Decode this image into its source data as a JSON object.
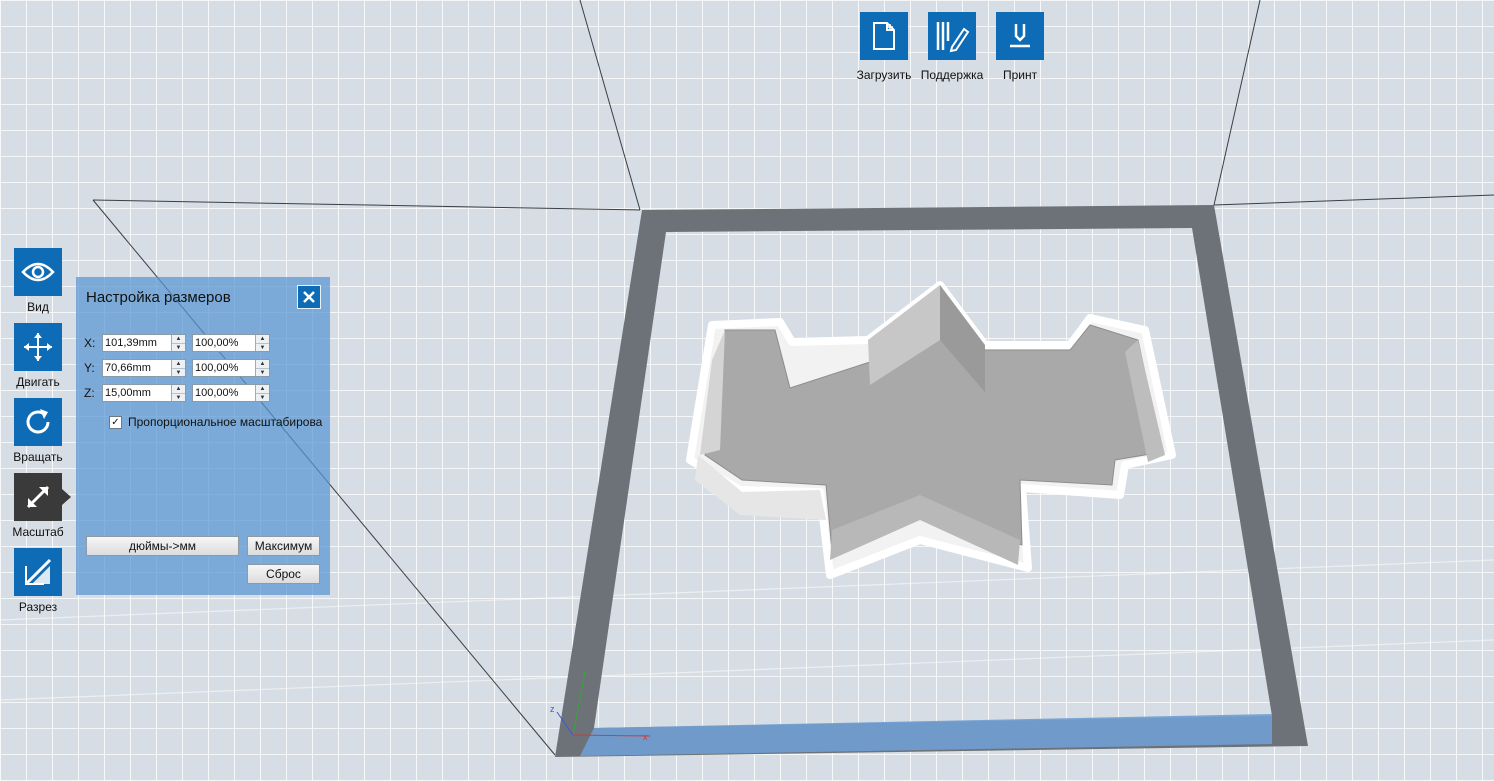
{
  "toolbar_top": [
    {
      "id": "load",
      "label": "Загрузить",
      "icon": "file-add-icon"
    },
    {
      "id": "support",
      "label": "Поддержка",
      "icon": "support-edit-icon"
    },
    {
      "id": "print",
      "label": "Принт",
      "icon": "print-nozzle-icon"
    }
  ],
  "toolbar_left": [
    {
      "id": "view",
      "label": "Вид",
      "icon": "eye-icon"
    },
    {
      "id": "move",
      "label": "Двигать",
      "icon": "move-arrows-icon"
    },
    {
      "id": "rotate",
      "label": "Вращать",
      "icon": "rotate-icon"
    },
    {
      "id": "scale",
      "label": "Масштаб",
      "icon": "scale-arrow-icon",
      "active": true
    },
    {
      "id": "cut",
      "label": "Разрез",
      "icon": "cut-icon"
    }
  ],
  "scale_panel": {
    "title": "Настройка размеров",
    "rows": [
      {
        "axis": "X:",
        "size": "101,39mm",
        "percent": "100,00%"
      },
      {
        "axis": "Y:",
        "size": "70,66mm",
        "percent": "100,00%"
      },
      {
        "axis": "Z:",
        "size": "15,00mm",
        "percent": "100,00%"
      }
    ],
    "proportional_label": "Пропорциональное масштабирова",
    "proportional_checked": true,
    "inch_to_mm_label": "дюймы->мм",
    "max_label": "Максимум",
    "reset_label": "Сброс"
  },
  "axes": {
    "x": "x",
    "y": "y",
    "z": "z"
  },
  "colors": {
    "accent": "#0d6cb5",
    "active": "#3a3a3a",
    "panel": "#5896d2",
    "plate_border": "#6d7278",
    "model": "#a9a9a9"
  }
}
